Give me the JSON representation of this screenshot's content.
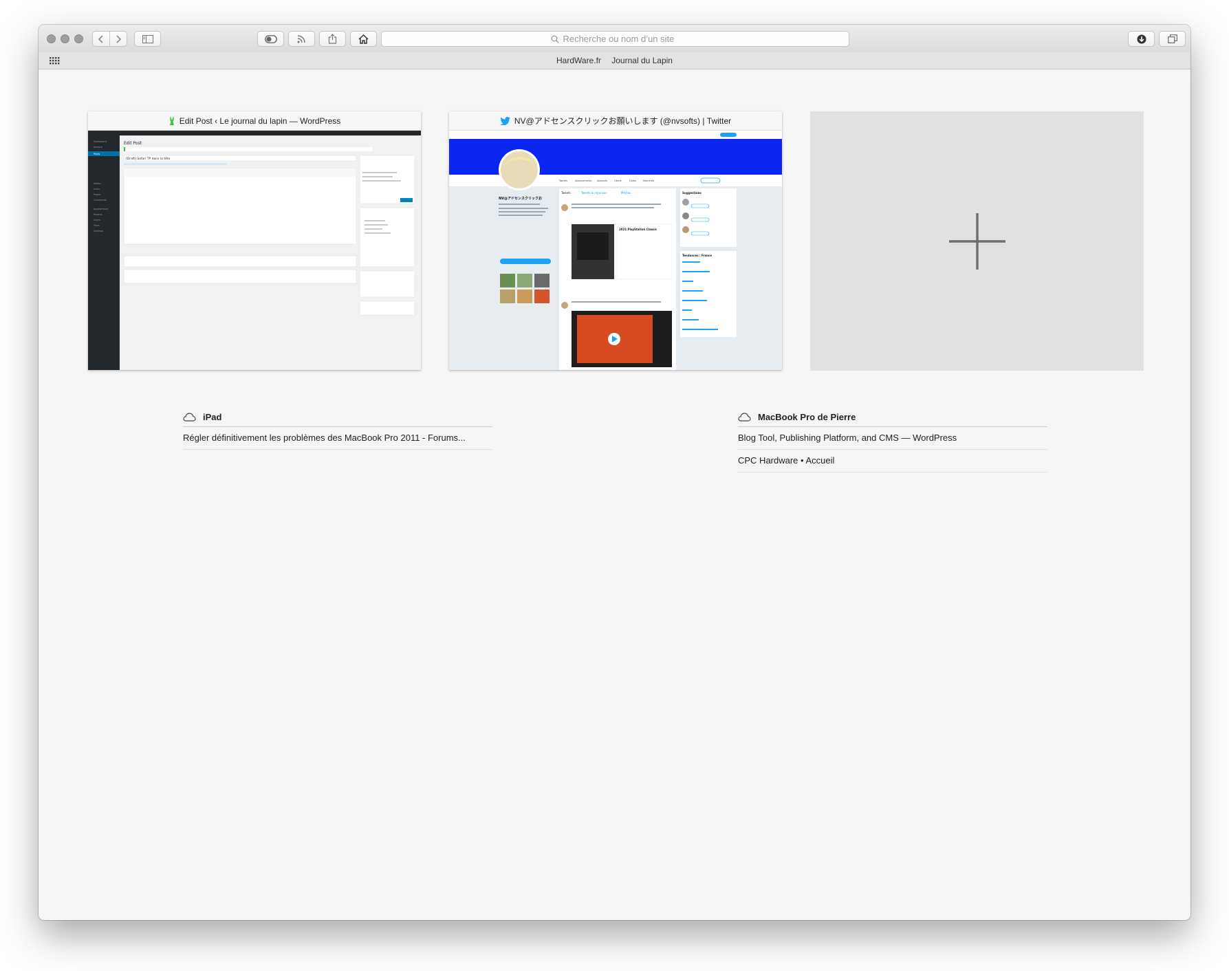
{
  "toolbar": {
    "search_placeholder": "Recherche ou nom d’un site"
  },
  "favorites": [
    "HardWare.fr",
    "Journal du Lapin"
  ],
  "top_sites": [
    {
      "title": "Edit Post ‹ Le journal du lapin — WordPress",
      "favicon": "rabbit-icon",
      "preview": {
        "heading": "Edit Post",
        "post_title": "[Draft] Safari TP dans la tête",
        "publish_button": "Update",
        "side_menu": [
          "Dashboard",
          "Jetpack",
          "Posts",
          "Media",
          "Links",
          "Pages",
          "Comments",
          "Appearance",
          "Plugins",
          "Users",
          "Tools",
          "Settings"
        ],
        "boxes": [
          "Publish",
          "Categories",
          "Tags",
          "Sharing",
          "Author"
        ]
      }
    },
    {
      "title": "NV@アドセンスクリックお願いします (@nvsofts) | Twitter",
      "favicon": "twitter-bird-icon",
      "preview": {
        "profile_name": "NV@アドセンスクリックお願いします",
        "tabs": [
          "Tweets",
          "Tweets & réponses",
          "Médias"
        ],
        "follow_button": "Abonné",
        "suggestions": "Suggestions",
        "trends": "Tendances : France"
      }
    }
  ],
  "add_tile_icon": "plus-icon",
  "devices": [
    {
      "name": "iPad",
      "tabs": [
        "Régler définitivement les problèmes des MacBook Pro 2011 - Forums..."
      ]
    },
    {
      "name": "MacBook Pro de Pierre",
      "tabs": [
        "Blog Tool, Publishing Platform, and CMS — WordPress",
        "CPC Hardware • Accueil"
      ]
    }
  ],
  "colors": {
    "twitter_blue": "#1da1f2",
    "twitter_banner": "#0a26f0",
    "wp_admin_bar": "#23282d"
  }
}
